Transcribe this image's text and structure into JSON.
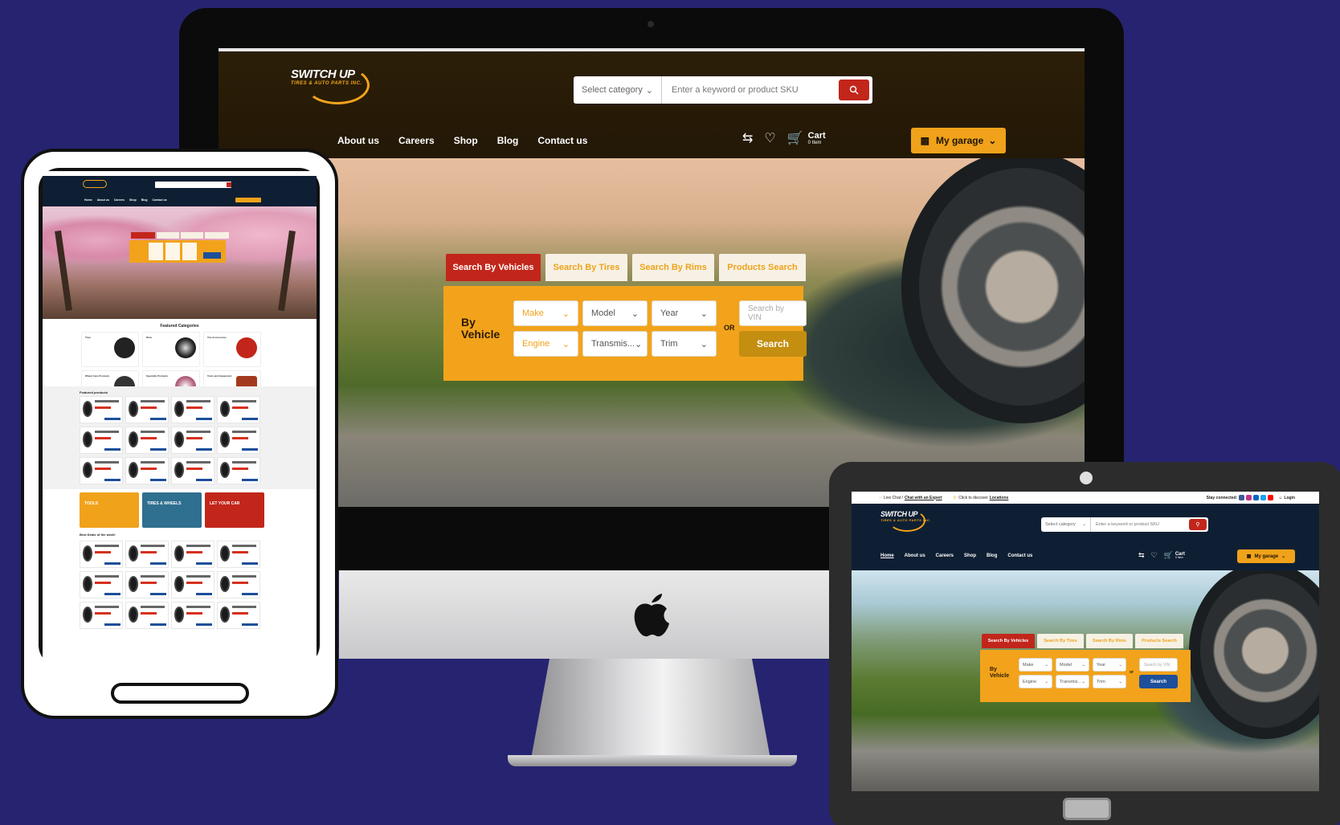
{
  "desktop": {
    "logo": {
      "line1": "SWITCH UP",
      "line2": "TIRES & AUTO PARTS INC."
    },
    "search": {
      "category": "Select category",
      "placeholder": "Enter a keyword or product SKU"
    },
    "nav": [
      "About us",
      "Careers",
      "Shop",
      "Blog",
      "Contact us"
    ],
    "cart": {
      "label": "Cart",
      "count": "0 Item"
    },
    "garage": "My garage",
    "tabs": [
      "Search By Vehicles",
      "Search By Tires",
      "Search By Rims",
      "Products Search"
    ],
    "panel": {
      "title_1": "By",
      "title_2": "Vehicle",
      "row1": [
        "Make",
        "Model",
        "Year"
      ],
      "row2": [
        "Engine",
        "Transmis...",
        "Trim"
      ],
      "or": "OR",
      "vin_placeholder": "Search by VIN",
      "search_button": "Search"
    }
  },
  "portrait": {
    "nav": [
      "Home",
      "About us",
      "Careers",
      "Shop",
      "Blog",
      "Contact us"
    ],
    "featured_categories": "Featured Categories",
    "featured_products": "Featured products",
    "best_deals": "Best Deals of the week!",
    "categories": [
      "Tires",
      "Rims",
      "Tire Accessories",
      "Wheel Care Products",
      "Specialty Products",
      "Tools and Equipment"
    ],
    "banners": [
      {
        "text": "TOOLS",
        "color": "#f0a21a"
      },
      {
        "text": "TIRES & WHEELS",
        "color": "#2f6f8f"
      },
      {
        "text": "LET YOUR CAR",
        "color": "#c2261b"
      }
    ]
  },
  "landscape": {
    "util": {
      "live_chat": "Live Chat /",
      "chat_link": "Chat with an Expert",
      "discover": "Click to discover",
      "locations": "Locations",
      "stay": "Stay connected:",
      "login": "Login"
    },
    "nav": [
      "Home",
      "About us",
      "Careers",
      "Shop",
      "Blog",
      "Contact us"
    ],
    "search": {
      "category": "Select category",
      "placeholder": "Enter a keyword or product SKU"
    },
    "cart": {
      "label": "Cart",
      "count": "0 Item"
    },
    "garage": "My garage",
    "tabs": [
      "Search By Vehicles",
      "Search By Tires",
      "Search By Rims",
      "Products Search"
    ],
    "panel": {
      "title_1": "By",
      "title_2": "Vehicle",
      "row1": [
        "Make",
        "Model",
        "Year"
      ],
      "row2": [
        "Engine",
        "Transmis...",
        "Trim"
      ],
      "or": "or",
      "vin_placeholder": "Search by VIN",
      "search_button": "Search"
    }
  },
  "colors": {
    "background": "#262470",
    "accent": "#f0a21a",
    "red": "#c2261b",
    "navy": "#0e1f33",
    "blue_button": "#1d4f9a"
  }
}
